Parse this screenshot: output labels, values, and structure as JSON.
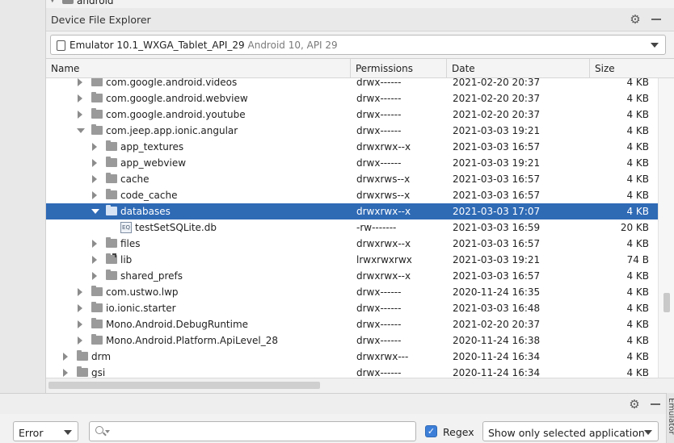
{
  "top_crumb": {
    "label": "android"
  },
  "panel": {
    "title": "Device File Explorer"
  },
  "device": {
    "name": "Emulator 10.1_WXGA_Tablet_API_29",
    "sub": "Android 10, API 29"
  },
  "columns": {
    "name": "Name",
    "permissions": "Permissions",
    "date": "Date",
    "size": "Size"
  },
  "rows": [
    {
      "name": "com.google.android.videos",
      "perm": "drwx------",
      "date": "2021-02-20 20:37",
      "size": "4 KB",
      "depth": 1,
      "exp": "collapsed",
      "icon": "folder"
    },
    {
      "name": "com.google.android.webview",
      "perm": "drwx------",
      "date": "2021-02-20 20:37",
      "size": "4 KB",
      "depth": 1,
      "exp": "collapsed",
      "icon": "folder"
    },
    {
      "name": "com.google.android.youtube",
      "perm": "drwx------",
      "date": "2021-02-20 20:37",
      "size": "4 KB",
      "depth": 1,
      "exp": "collapsed",
      "icon": "folder"
    },
    {
      "name": "com.jeep.app.ionic.angular",
      "perm": "drwx------",
      "date": "2021-03-03 19:21",
      "size": "4 KB",
      "depth": 1,
      "exp": "expanded",
      "icon": "folder"
    },
    {
      "name": "app_textures",
      "perm": "drwxrwx--x",
      "date": "2021-03-03 16:57",
      "size": "4 KB",
      "depth": 2,
      "exp": "collapsed",
      "icon": "folder"
    },
    {
      "name": "app_webview",
      "perm": "drwx------",
      "date": "2021-03-03 19:21",
      "size": "4 KB",
      "depth": 2,
      "exp": "collapsed",
      "icon": "folder"
    },
    {
      "name": "cache",
      "perm": "drwxrws--x",
      "date": "2021-03-03 16:57",
      "size": "4 KB",
      "depth": 2,
      "exp": "collapsed",
      "icon": "folder"
    },
    {
      "name": "code_cache",
      "perm": "drwxrws--x",
      "date": "2021-03-03 16:57",
      "size": "4 KB",
      "depth": 2,
      "exp": "collapsed",
      "icon": "folder"
    },
    {
      "name": "databases",
      "perm": "drwxrwx--x",
      "date": "2021-03-03 17:07",
      "size": "4 KB",
      "depth": 2,
      "exp": "expanded",
      "icon": "folder",
      "selected": true
    },
    {
      "name": "testSetSQLite.db",
      "perm": "-rw-------",
      "date": "2021-03-03 16:59",
      "size": "20 KB",
      "depth": 3,
      "exp": "none",
      "icon": "db"
    },
    {
      "name": "files",
      "perm": "drwxrwx--x",
      "date": "2021-03-03 16:57",
      "size": "4 KB",
      "depth": 2,
      "exp": "collapsed",
      "icon": "folder"
    },
    {
      "name": "lib",
      "perm": "lrwxrwxrwx",
      "date": "2021-03-03 19:21",
      "size": "74 B",
      "depth": 2,
      "exp": "collapsed",
      "icon": "link"
    },
    {
      "name": "shared_prefs",
      "perm": "drwxrwx--x",
      "date": "2021-03-03 16:57",
      "size": "4 KB",
      "depth": 2,
      "exp": "collapsed",
      "icon": "folder"
    },
    {
      "name": "com.ustwo.lwp",
      "perm": "drwx------",
      "date": "2020-11-24 16:35",
      "size": "4 KB",
      "depth": 1,
      "exp": "collapsed",
      "icon": "folder"
    },
    {
      "name": "io.ionic.starter",
      "perm": "drwx------",
      "date": "2021-03-03 16:48",
      "size": "4 KB",
      "depth": 1,
      "exp": "collapsed",
      "icon": "folder"
    },
    {
      "name": "Mono.Android.DebugRuntime",
      "perm": "drwx------",
      "date": "2021-02-20 20:37",
      "size": "4 KB",
      "depth": 1,
      "exp": "collapsed",
      "icon": "folder"
    },
    {
      "name": "Mono.Android.Platform.ApiLevel_28",
      "perm": "drwx------",
      "date": "2020-11-24 16:38",
      "size": "4 KB",
      "depth": 1,
      "exp": "collapsed",
      "icon": "folder"
    },
    {
      "name": "drm",
      "perm": "drwxrwx---",
      "date": "2020-11-24 16:34",
      "size": "4 KB",
      "depth": 0,
      "exp": "collapsed",
      "icon": "folder"
    },
    {
      "name": "gsi",
      "perm": "drwx------",
      "date": "2020-11-24 16:34",
      "size": "4 KB",
      "depth": 0,
      "exp": "collapsed",
      "icon": "folder"
    }
  ],
  "logcat": {
    "level": "Error",
    "search_value": "",
    "regex_checked": true,
    "regex_label": "Regex",
    "filter": "Show only selected application"
  },
  "side_strip_label": "Emulator",
  "colors": {
    "selection": "#2f6ab5",
    "checkbox": "#3d7fd8"
  }
}
